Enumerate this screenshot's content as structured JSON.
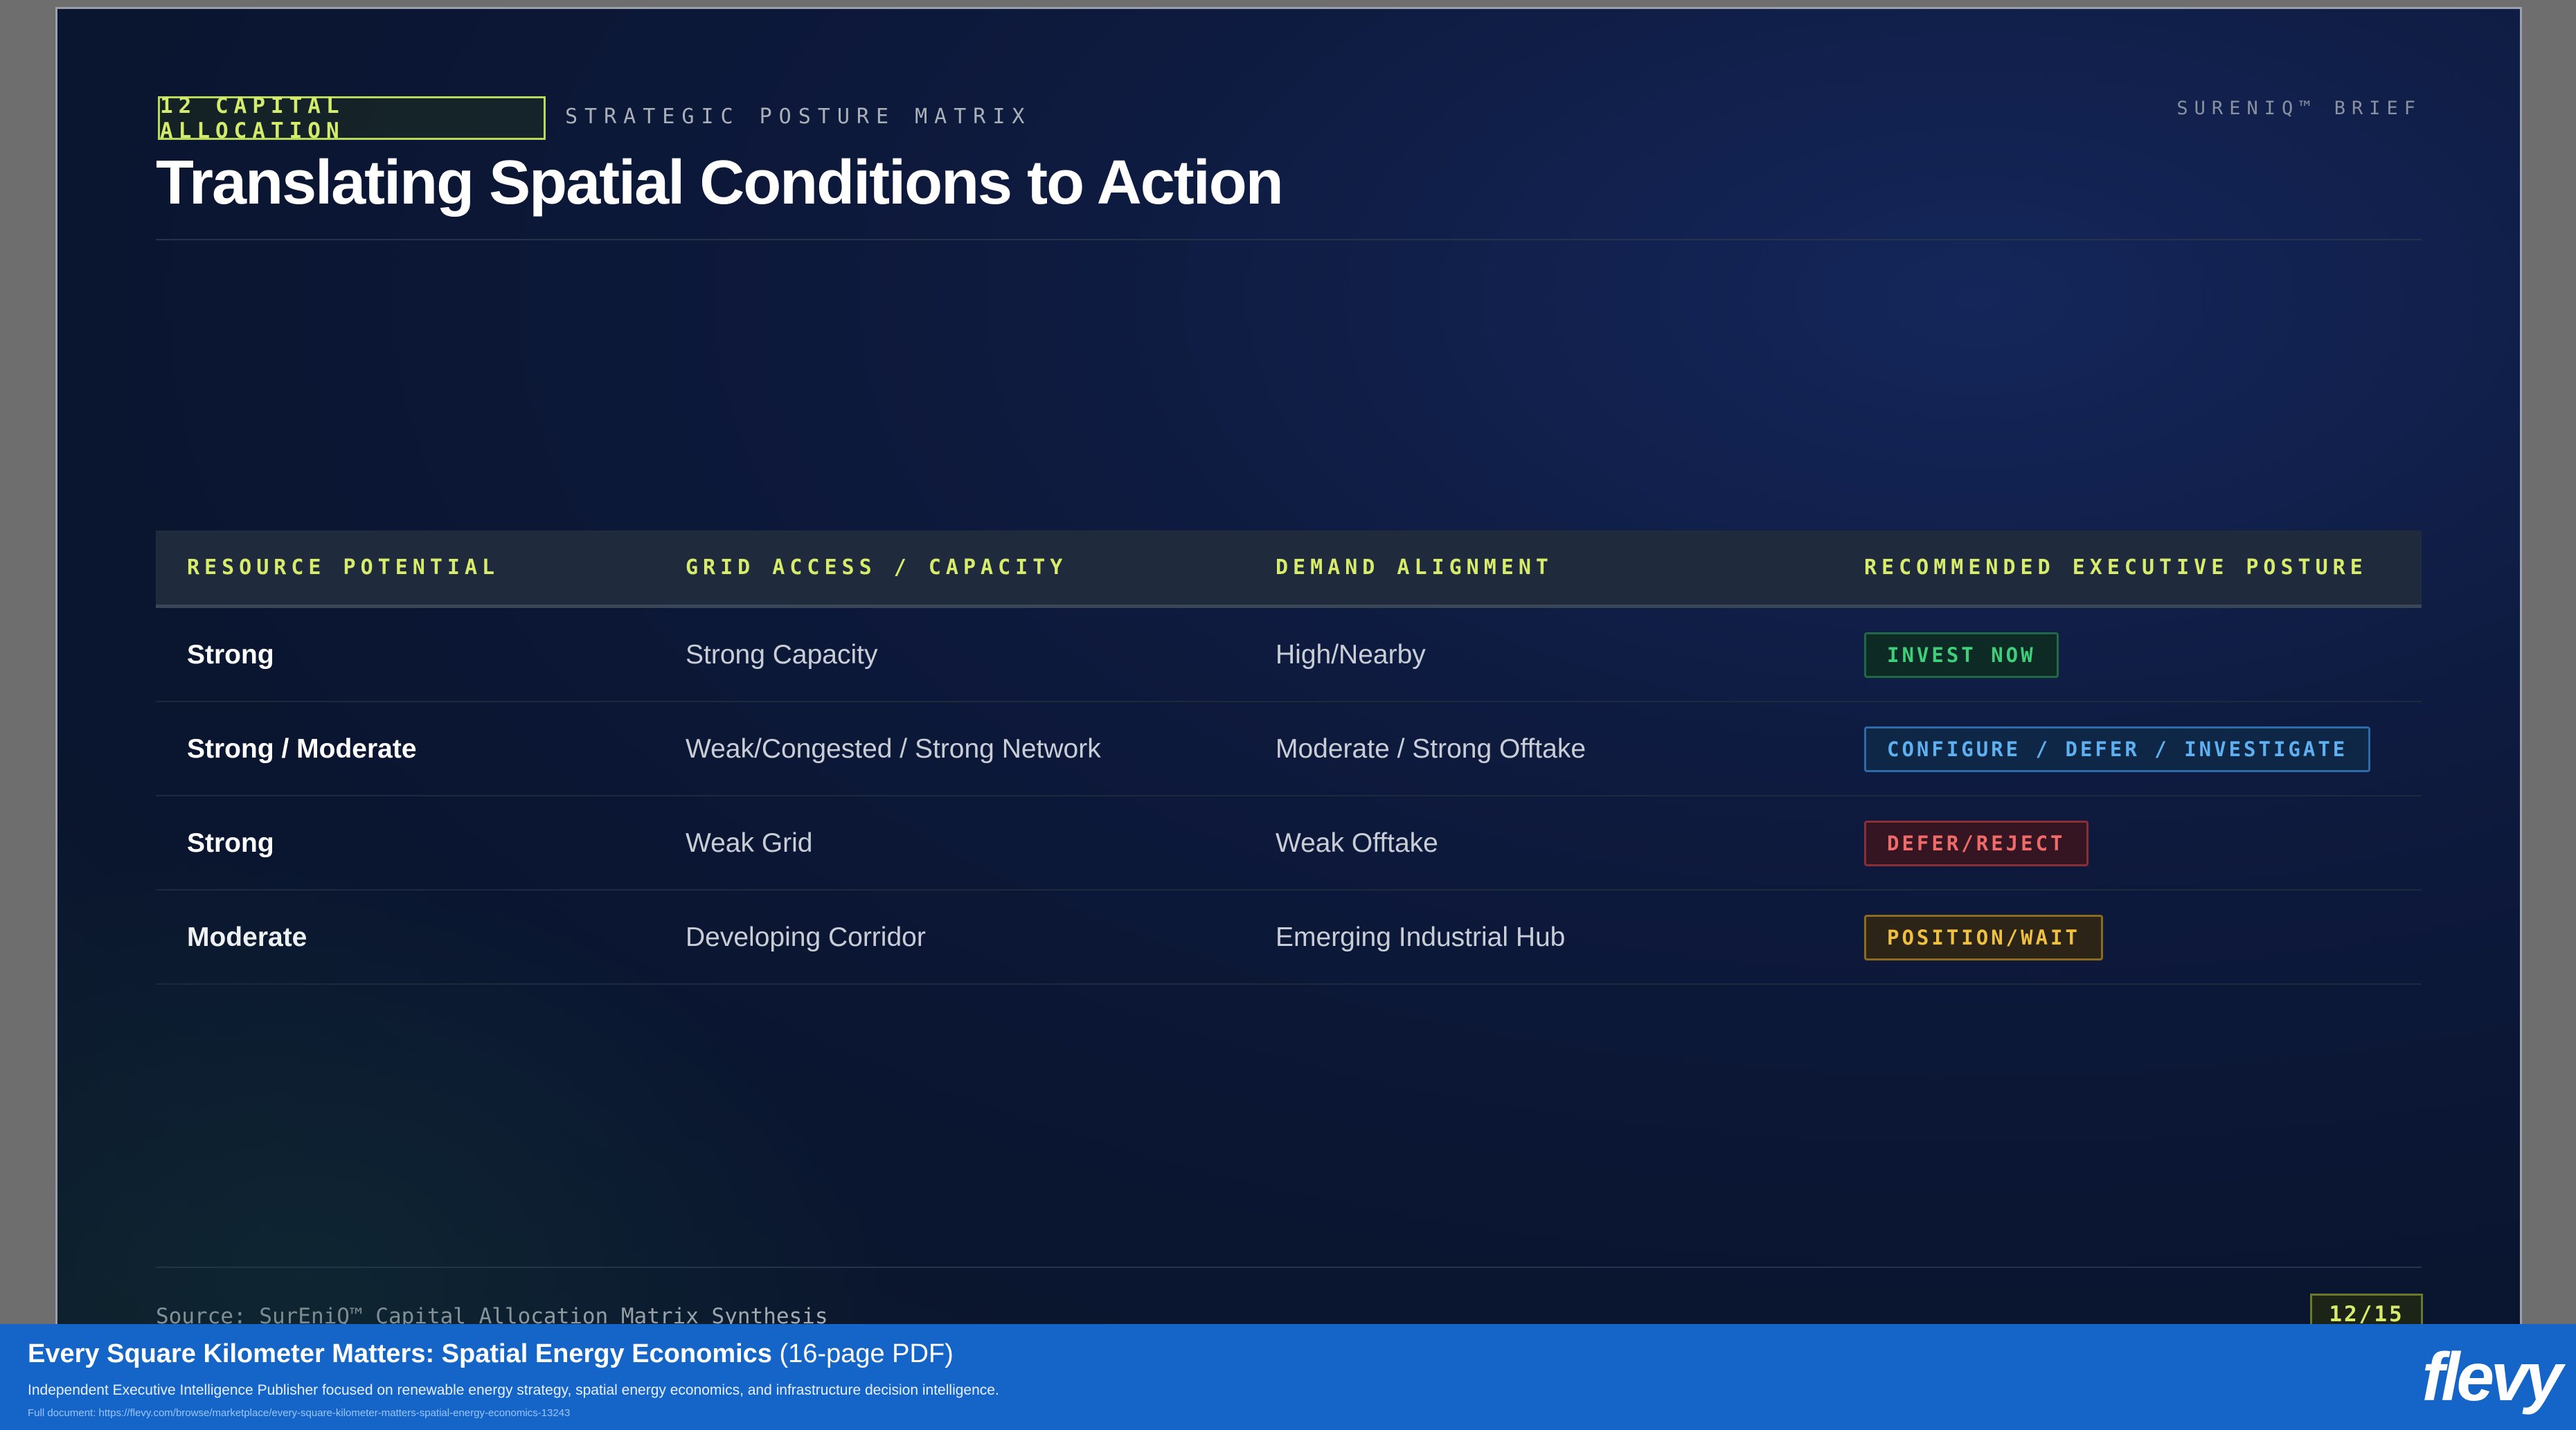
{
  "slide": {
    "section_tag": "12 CAPITAL ALLOCATION",
    "section_sub": "STRATEGIC POSTURE MATRIX",
    "brand": "SURENIQ™ BRIEF",
    "title": "Translating Spatial Conditions to Action"
  },
  "table": {
    "headers": [
      "RESOURCE POTENTIAL",
      "GRID ACCESS / CAPACITY",
      "DEMAND ALIGNMENT",
      "RECOMMENDED EXECUTIVE POSTURE"
    ],
    "rows": [
      {
        "resource": "Strong",
        "grid": "Strong Capacity",
        "demand": "High/Nearby",
        "posture": "INVEST NOW",
        "posture_color": "#3fcf7a"
      },
      {
        "resource": "Strong / Moderate",
        "grid": "Weak/Congested / Strong Network",
        "demand": "Moderate / Strong Offtake",
        "posture": "CONFIGURE / DEFER / INVESTIGATE",
        "posture_color": "#5fb0f0"
      },
      {
        "resource": "Strong",
        "grid": "Weak Grid",
        "demand": "Weak Offtake",
        "posture": "DEFER/REJECT",
        "posture_color": "#f06a6a"
      },
      {
        "resource": "Moderate",
        "grid": "Developing Corridor",
        "demand": "Emerging Industrial Hub",
        "posture": "POSITION/WAIT",
        "posture_color": "#f0c040"
      }
    ]
  },
  "footer": {
    "source": "Source: SurEniQ™ Capital Allocation Matrix Synthesis",
    "page": "12/15"
  },
  "banner": {
    "title_bold": "Every Square Kilometer Matters: Spatial Energy Economics",
    "title_suffix": " (16-page PDF)",
    "description": "Independent Executive Intelligence Publisher focused on renewable energy strategy, spatial energy economics, and infrastructure decision intelligence.",
    "link": "Full document: https://flevy.com/browse/marketplace/every-square-kilometer-matters-spatial-energy-economics-13243",
    "logo": "flevy"
  }
}
